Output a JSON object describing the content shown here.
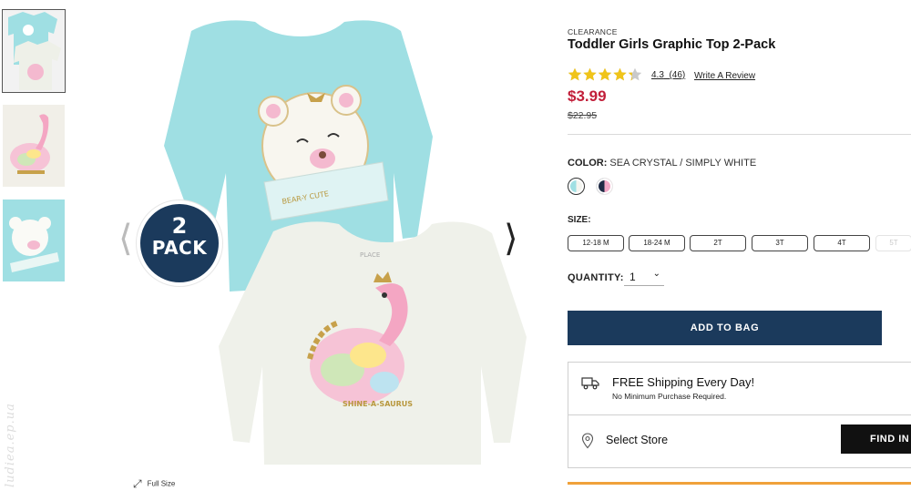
{
  "gallery": {
    "thumbnails": [
      {
        "name": "Two-pack front view",
        "selected": true
      },
      {
        "name": "Dinosaur top detail",
        "selected": false
      },
      {
        "name": "Bear top detail",
        "selected": false
      }
    ],
    "badge": {
      "number": "2",
      "label": "PACK"
    },
    "prev_icon": "chevron-left-icon",
    "next_icon": "chevron-right-icon",
    "fullsize_label": "Full Size",
    "fullsize_icon": "expand-icon",
    "graphic_text": {
      "bear": "BEAR-Y CUTE",
      "dino": "SHINE-A-SAURUS",
      "brand": "PLACE"
    }
  },
  "product": {
    "tag": "CLEARANCE",
    "title": "Toddler Girls Graphic Top 2-Pack",
    "rating": {
      "value": "4.3",
      "count": "(46)",
      "stars": 4.3,
      "max": 5
    },
    "write_review": "Write A Review",
    "price": "$3.99",
    "old_price": "$22.95",
    "color": {
      "label": "COLOR:",
      "selected": "SEA CRYSTAL / SIMPLY WHITE",
      "swatches": [
        {
          "name": "Sea Crystal / Simply White",
          "colors": [
            "#9fdfe3",
            "#f3f4ef"
          ],
          "selected": true
        },
        {
          "name": "Navy / Pink",
          "colors": [
            "#1f2b46",
            "#f3a8c7"
          ],
          "selected": false
        }
      ]
    },
    "size": {
      "label": "SIZE:",
      "options": [
        {
          "label": "12-18 M",
          "available": true
        },
        {
          "label": "18-24 M",
          "available": true
        },
        {
          "label": "2T",
          "available": true
        },
        {
          "label": "3T",
          "available": true
        },
        {
          "label": "4T",
          "available": true
        },
        {
          "label": "5T",
          "available": false
        }
      ]
    },
    "quantity": {
      "label": "QUANTITY:",
      "value": "1"
    },
    "add_to_bag": "ADD TO BAG",
    "shipping": {
      "title": "FREE Shipping Every Day!",
      "subtitle": "No Minimum Purchase Required.",
      "icon": "truck-icon"
    },
    "store": {
      "label": "Select Store",
      "button": "FIND IN",
      "icon": "location-pin-icon"
    }
  },
  "colors": {
    "navy": "#1b3a5c",
    "sale_red": "#c21f3a",
    "star_gold": "#f0c419",
    "accent_orange": "#f0a13a"
  },
  "watermark": "ludiea.ep.ua"
}
